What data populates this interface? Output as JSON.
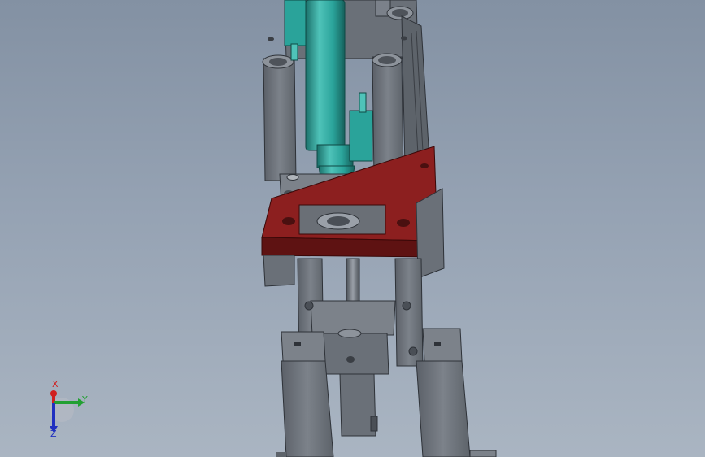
{
  "viewport": {
    "background_top": "#8391a3",
    "background_bottom": "#aab5c2"
  },
  "model": {
    "colors": {
      "frame": "#70767e",
      "frame_dark": "#4d5259",
      "frame_light": "#8a9098",
      "plate": "#8c1f1f",
      "plate_dark": "#5e1212",
      "cylinder": "#2aa39a",
      "cylinder_dark": "#1a706a",
      "cylinder_light": "#4fc3b9"
    }
  },
  "triad": {
    "x_label": "X",
    "y_label": "Y",
    "z_label": "Z",
    "x_color": "#d02020",
    "y_color": "#22a032",
    "z_color": "#2030c0"
  }
}
